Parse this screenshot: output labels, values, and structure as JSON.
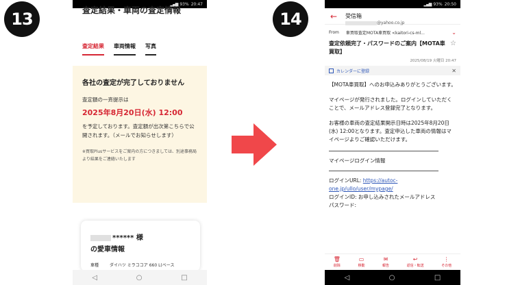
{
  "steps": {
    "left": "13",
    "right": "14"
  },
  "left_phone": {
    "title": "査定結果・車両の査定情報",
    "tabs": [
      "査定結果",
      "車両情報",
      "写真"
    ],
    "notice": {
      "heading": "各社の査定が完了しておりません",
      "line1": "査定額の一斉提示は",
      "date": "2025年8月20日(水) 12:00",
      "line2": "を予定しております。査定額が出次第こちらで公開されます。（メールでお知らせします）",
      "note": "※買取Plusサービスをご案内の方につきましては、別途事務局より結果をご連絡いたします"
    },
    "card": {
      "user": "****** 様",
      "heading": "の愛車情報",
      "row_label": "車種",
      "row_value": "ダイハツ ミラココア 660 L(ベース"
    },
    "nav": [
      "◁",
      "○",
      "□"
    ]
  },
  "right_phone": {
    "status": {
      "battery": "93%",
      "time": "20:50"
    },
    "header_title": "受信箱",
    "account": "@yahoo.co.jp",
    "from_label": "From",
    "from_value": "車買取査定MOTA車買取 <kaitori-cs-ml...",
    "subject": "査定依頼完了・パスワードのご案内【MOTA車買取】",
    "date": "2025/08/19 火曜日 20:47",
    "calendar": "カレンダーに登録",
    "body": {
      "p1": "【MOTA車買取】へのお申込みありがとうございます。",
      "p2": "マイページが発行されました。ログインしていただくことで、メールアドレス登録完了となります。",
      "p3": "お客様の車両の査定結果開示日時は2025年8月20日(水) 12:00となります。査定申込した車両の情報はマイページよりご確認いただけます。",
      "login_title": "マイページログイン情報",
      "url_label": "ログインURL: ",
      "url": "https://autoc-one.jp/ullo/user/mypage/",
      "id_line": "ログインID: お申し込みされたメールアドレス",
      "pw_line": "パスワード:"
    },
    "toolbar": [
      "削除",
      "移動",
      "報告",
      "返信・転送",
      "その他"
    ],
    "nav": [
      "◁",
      "○",
      "□"
    ]
  },
  "left_status": {
    "battery": "93%",
    "time": "20:47"
  }
}
